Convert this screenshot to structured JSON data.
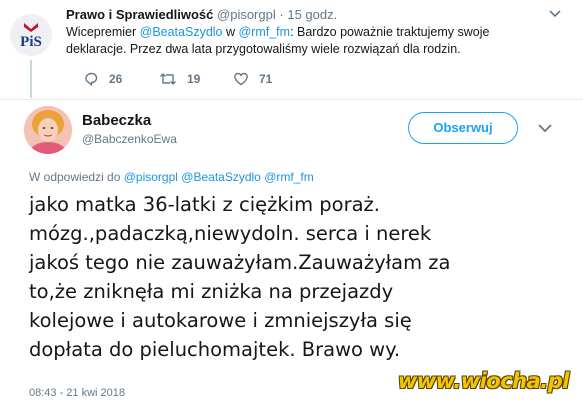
{
  "parent_tweet": {
    "account_name": "Prawo i Sprawiedliwość",
    "handle": "@pisorgpl",
    "separator": "·",
    "time_ago": "15 godz.",
    "text_prefix": "Wicepremier ",
    "mention_1": "@BeataSzydlo",
    "text_mid": " w ",
    "mention_2": "@rmf_fm",
    "text_suffix": ": Bardzo poważnie traktujemy swoje deklaracje. Przez dwa lata przygotowaliśmy wiele rozwiązań dla rodzin.",
    "replies": "26",
    "retweets": "19",
    "likes": "71",
    "logo_text": "PiS"
  },
  "tweet": {
    "display_name": "Babeczka",
    "handle": "@BabczenkoEwa",
    "follow_label": "Obserwuj",
    "reply_to_label": "W odpowiedzi do",
    "reply_to_1": "@pisorgpl",
    "reply_to_2": "@BeataSzydlo",
    "reply_to_3": "@rmf_fm",
    "lines": [
      "jako matka 36-latki z ciężkim poraż.",
      "mózg.,padaczką,niewydoln. serca i nerek",
      "jakoś tego nie zauważyłam.Zauważyłam za",
      "to,że zniknęła mi zniżka na przejazdy",
      "kolejowe i autokarowe i zmniejszyła się",
      "dopłata do pieluchomajtek. Brawo wy."
    ],
    "timestamp": "08:43 - 21 kwi 2018"
  },
  "watermark": "www.wiocha.pl",
  "colors": {
    "accent": "#1da1f2",
    "link": "#1b95e0",
    "muted": "#657786",
    "text": "#14171a",
    "watermark": "#f5c400"
  },
  "icons": {
    "reply": "reply-icon",
    "retweet": "retweet-icon",
    "like": "heart-icon",
    "more": "chevron-down-icon"
  }
}
